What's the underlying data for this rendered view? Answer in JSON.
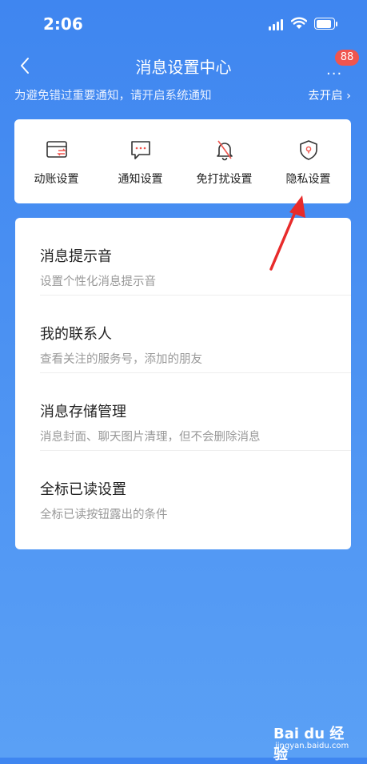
{
  "status_bar": {
    "time": "2:06"
  },
  "nav": {
    "title": "消息设置中心",
    "badge_count": "88"
  },
  "notice": {
    "text": "为避免错过重要通知，请开启系统通知",
    "action": "去开启 ›"
  },
  "shortcuts": [
    {
      "label": "动账设置",
      "icon": "card-transfer-icon"
    },
    {
      "label": "通知设置",
      "icon": "message-dots-icon"
    },
    {
      "label": "免打扰设置",
      "icon": "bell-off-icon"
    },
    {
      "label": "隐私设置",
      "icon": "shield-icon"
    }
  ],
  "settings": [
    {
      "title": "消息提示音",
      "desc": "设置个性化消息提示音"
    },
    {
      "title": "我的联系人",
      "desc": "查看关注的服务号，添加的朋友"
    },
    {
      "title": "消息存储管理",
      "desc": "消息封面、聊天图片清理，但不会删除消息"
    },
    {
      "title": "全标已读设置",
      "desc": "全标已读按钮露出的条件"
    }
  ],
  "watermark": {
    "brand": "Bai du 经验",
    "sub": "jingyan.baidu.com"
  },
  "colors": {
    "accent_red": "#f0554e",
    "background_blue": "#4a90f2",
    "annotation_arrow": "#e82b2b"
  }
}
